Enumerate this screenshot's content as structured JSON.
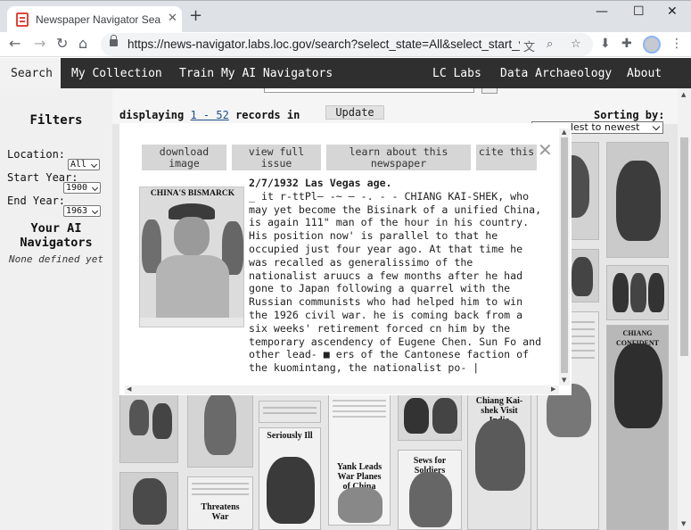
{
  "browser": {
    "tab_title": "Newspaper Navigator Search R",
    "tab_close": "✕",
    "new_tab": "+",
    "url": "https://news-navigator.labs.loc.gov/search?select_state=All&select_start_year=...",
    "win_min": "—",
    "win_max": "☐",
    "win_close": "✕"
  },
  "nav": {
    "search": "Search",
    "collection": "My Collection",
    "train": "Train My AI Navigators",
    "lclabs": "LC Labs",
    "archaeology": "Data Archaeology",
    "about": "About"
  },
  "sidebar": {
    "title": "Filters",
    "location_label": "Location:",
    "location_value": "All",
    "start_label": "Start Year:",
    "start_value": "1900",
    "end_label": "End Year:",
    "end_value": "1963",
    "ai_title": "Your AI Navigators",
    "ai_none": "None defined yet"
  },
  "results": {
    "displaying": "displaying",
    "range": "1 - 52",
    "records_in": "records in",
    "update": "Update",
    "sorting_label": "Sorting by:",
    "sort_value": "ldest to newest"
  },
  "thumbnails": {
    "seriously": "Seriously Ill",
    "yank": "Yank Leads War Planes of China",
    "sews": "Sews for Soldiers",
    "threatens": "Threatens War",
    "chiang_confident": "CHIANG CONFIDENT",
    "chiang_visit": "Chiang Kai-shek Visit India"
  },
  "modal": {
    "download": "download image",
    "view_full": "view full issue",
    "learn": "learn about this newspaper",
    "cite": "cite this",
    "close": "✕",
    "clip_head": "CHINA'S BISMARCK",
    "date_line": "2/7/1932 Las Vegas age.",
    "body": "_ it r-ttPl— -~ — -. - - CHIANG KAI-SHEK, who may yet become the Bisinark of a unified China, is again 111\" man of the hour in his country. His position now' is parallel to that he occupied just four year ago. At that time he was recalled as generalissimo of the nationalist aruucs a few months after he had gone to Japan following a quarrel with the Russian communists who had helped him to win the 1926 civil war. he is coming back from a six weeks' retirement forced cn him by the temporary ascendency of Eugene Chen. Sun Fo and other lead- ■ ers of the Cantonese faction of the kuomintang, the nationalist po- |"
  }
}
